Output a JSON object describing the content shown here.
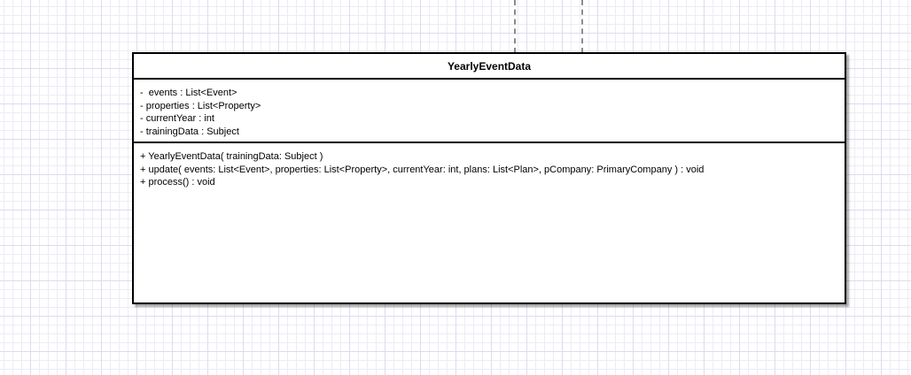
{
  "class": {
    "name": "YearlyEventData",
    "attributes": [
      "-  events : List<Event>",
      "- properties : List<Property>",
      "- currentYear : int",
      "- trainingData : Subject"
    ],
    "operations": [
      "+ YearlyEventData( trainingData: Subject )",
      "+ update( events: List<Event>, properties: List<Property>, currentYear: int, plans: List<Plan>, pCompany: PrimaryCompany ) : void",
      "+ process() : void"
    ]
  }
}
